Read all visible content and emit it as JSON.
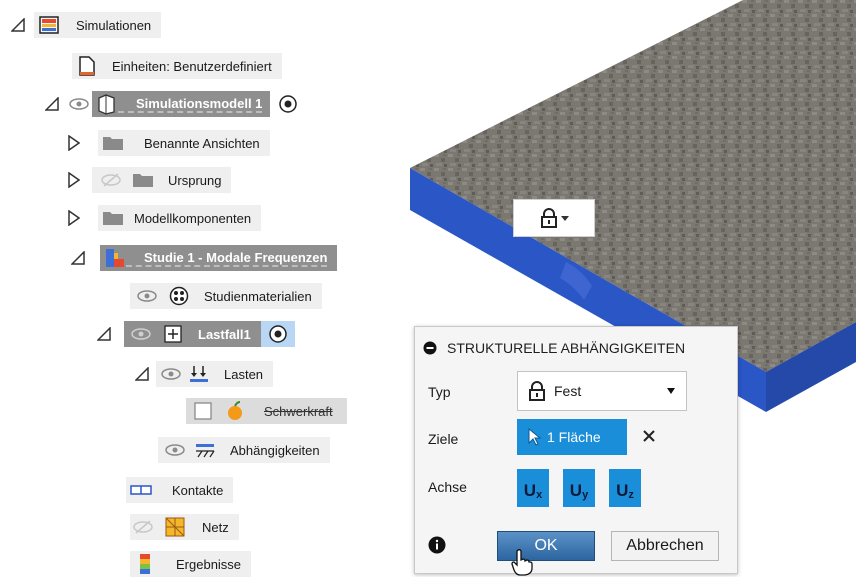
{
  "tree": {
    "root": {
      "label": "Simulationen"
    },
    "units": {
      "label": "Einheiten: Benutzerdefiniert"
    },
    "model": {
      "label": "Simulationsmodell 1"
    },
    "named_views": {
      "label": "Benannte Ansichten"
    },
    "origin": {
      "label": "Ursprung"
    },
    "components": {
      "label": "Modellkomponenten"
    },
    "study": {
      "label": "Studie 1 - Modale Frequenzen"
    },
    "materials": {
      "label": "Studienmaterialien"
    },
    "loadcase": {
      "label": "Lastfall1"
    },
    "loads": {
      "label": "Lasten"
    },
    "gravity": {
      "label": "Schwerkraft"
    },
    "constraints": {
      "label": "Abhängigkeiten"
    },
    "contacts": {
      "label": "Kontakte"
    },
    "mesh": {
      "label": "Netz"
    },
    "results": {
      "label": "Ergebnisse"
    }
  },
  "dialog": {
    "title": "STRUKTURELLE ABHÄNGIGKEITEN",
    "type_label": "Typ",
    "type_value": "Fest",
    "targets_label": "Ziele",
    "targets_value": "1 Fläche",
    "axis_label": "Achse",
    "axes": [
      {
        "main": "U",
        "sub": "x"
      },
      {
        "main": "U",
        "sub": "y"
      },
      {
        "main": "U",
        "sub": "z"
      }
    ],
    "ok_label": "OK",
    "cancel_label": "Abbrechen"
  },
  "colors": {
    "accent": "#1a8ed8",
    "selected_row": "#8a8a8a",
    "slab_top": "#7a7670",
    "slab_side": "#2a55c8"
  }
}
